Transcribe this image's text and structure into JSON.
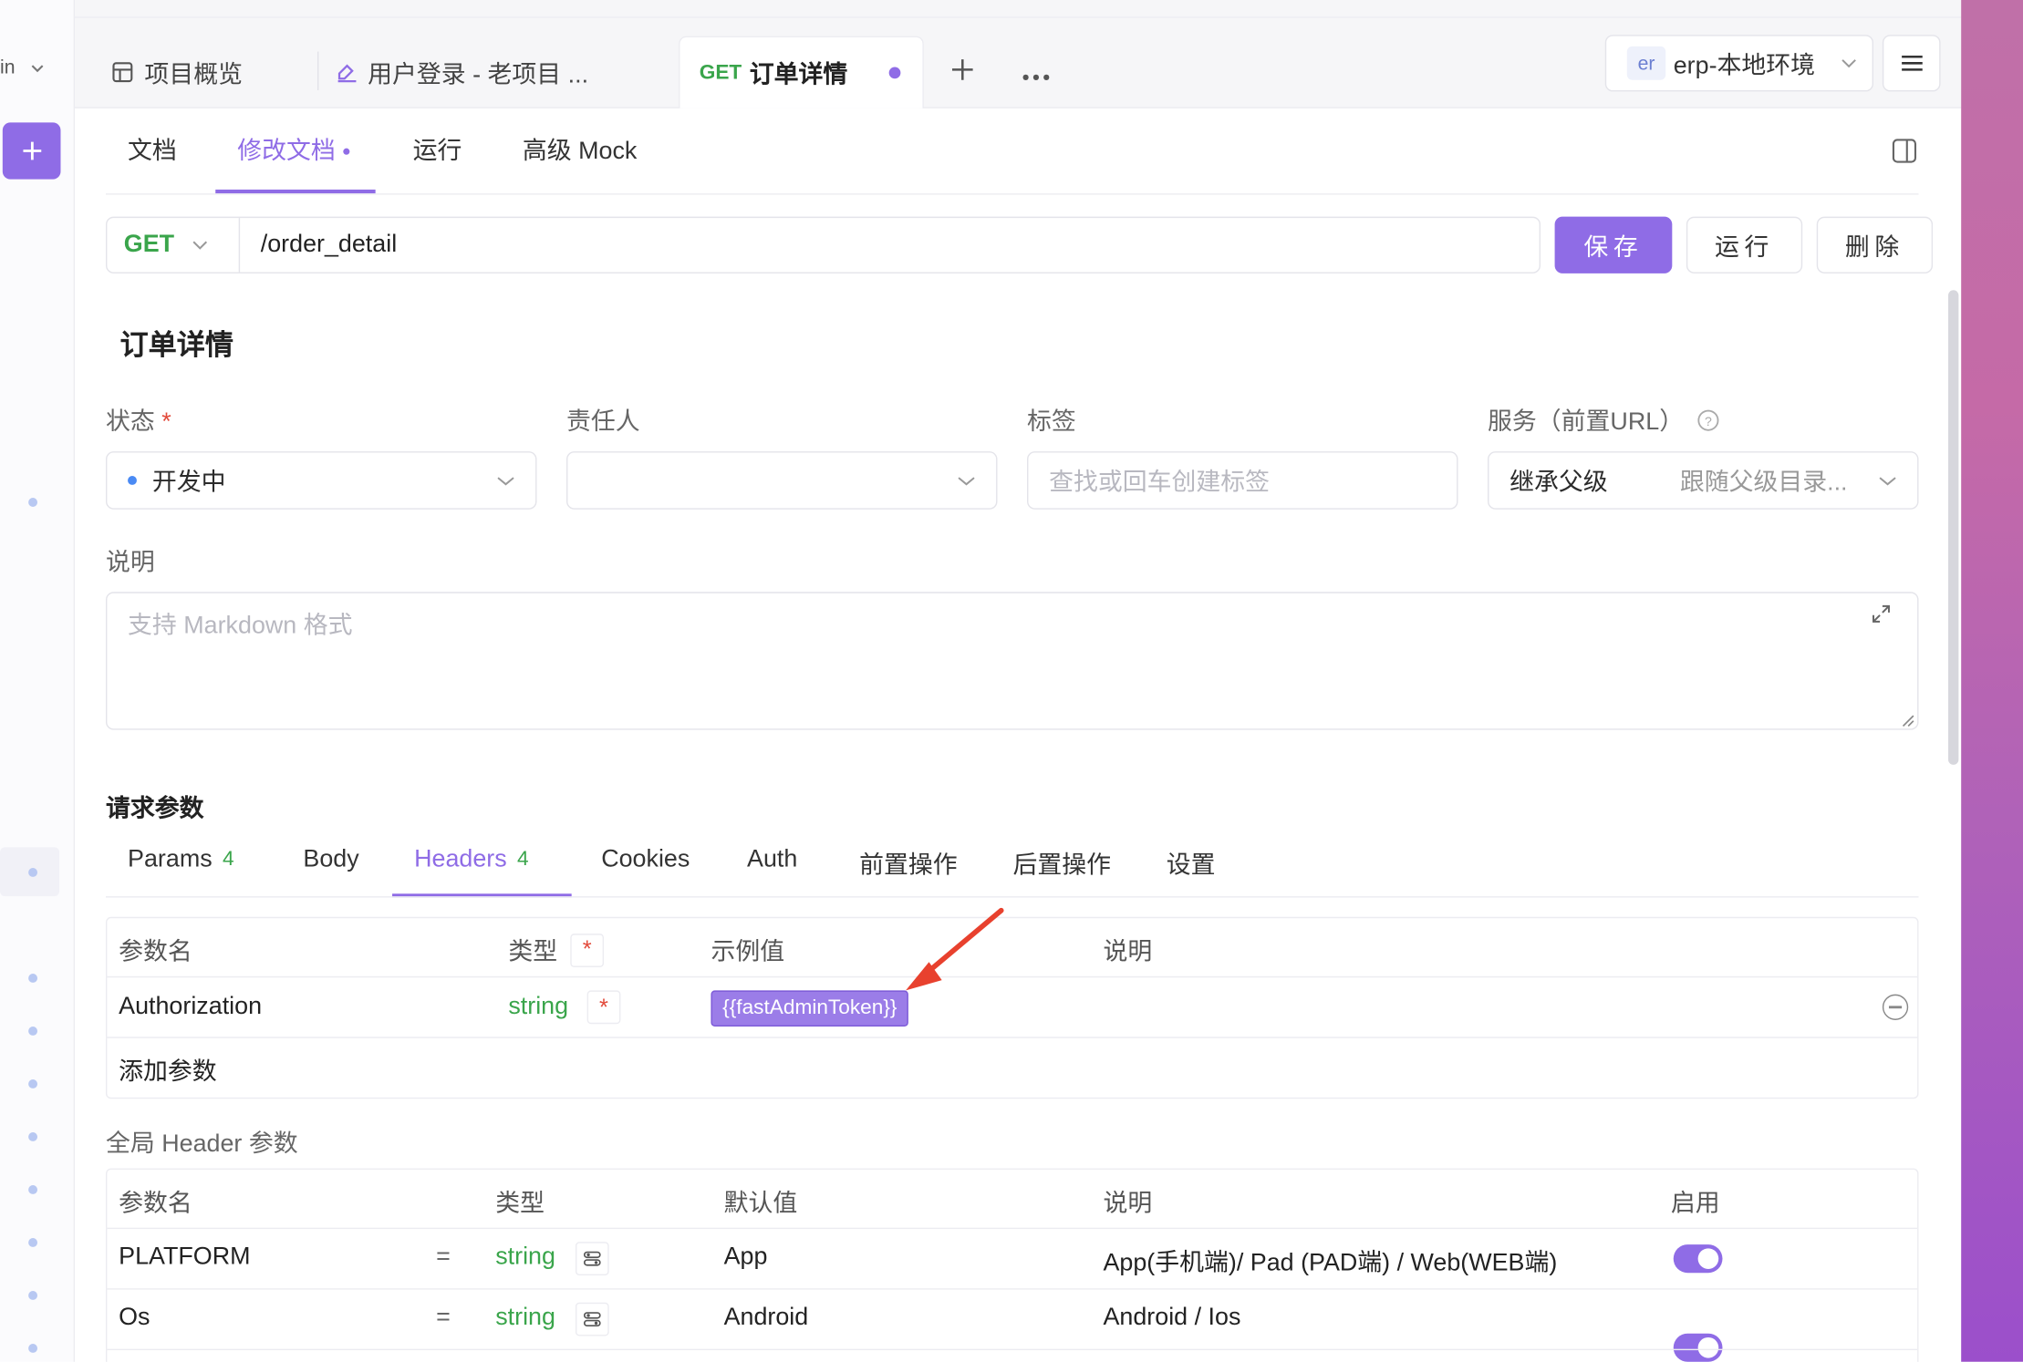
{
  "rail": {
    "top_label": "in",
    "add_icon": "plus-icon"
  },
  "tabs": [
    {
      "icon": "layout-icon",
      "label": "项目概览"
    },
    {
      "icon": "api-icon",
      "label": "用户登录 - 老项目 ..."
    },
    {
      "method": "GET",
      "label": "订单详情",
      "active": true
    }
  ],
  "tabbar": {
    "add_icon": "plus-icon",
    "more_icon": "more-icon"
  },
  "env": {
    "badge": "er",
    "name": "erp-本地环境"
  },
  "subtabs": {
    "doc": "文档",
    "edit": "修改文档",
    "run": "运行",
    "mock": "高级 Mock"
  },
  "request": {
    "method": "GET",
    "path": "/order_detail"
  },
  "actions": {
    "save": "保存",
    "run": "运行",
    "delete": "删除"
  },
  "api_title": "订单详情",
  "fields": {
    "status_label": "状态",
    "status_required": "*",
    "status_value": "开发中",
    "owner_label": "责任人",
    "tags_label": "标签",
    "tags_placeholder": "查找或回车创建标签",
    "service_label": "服务（前置URL）",
    "service_value": "继承父级",
    "service_hint": "跟随父级目录..."
  },
  "description": {
    "label": "说明",
    "placeholder": "支持 Markdown 格式"
  },
  "params_section": "请求参数",
  "param_tabs": {
    "params": "Params",
    "params_count": "4",
    "body": "Body",
    "headers": "Headers",
    "headers_count": "4",
    "cookies": "Cookies",
    "auth": "Auth",
    "pre": "前置操作",
    "post": "后置操作",
    "settings": "设置"
  },
  "headers_table": {
    "cols": {
      "name": "参数名",
      "type": "类型",
      "example": "示例值",
      "desc": "说明"
    },
    "type_required": "*",
    "rows": [
      {
        "name": "Authorization",
        "type": "string",
        "required": "*",
        "example": "{{fastAdminToken}}"
      }
    ],
    "add_placeholder": "添加参数"
  },
  "global_headers": {
    "label": "全局 Header 参数",
    "cols": {
      "name": "参数名",
      "type": "类型",
      "default": "默认值",
      "desc": "说明",
      "enabled": "启用"
    },
    "rows": [
      {
        "name": "PLATFORM",
        "eq": "=",
        "type": "string",
        "default": "App",
        "desc": "App(手机端)/ Pad (PAD端) / Web(WEB端)",
        "enabled": true
      },
      {
        "name": "Os",
        "eq": "=",
        "type": "string",
        "default": "Android",
        "desc": "Android / Ios",
        "enabled": true
      }
    ]
  },
  "colors": {
    "accent": "#8f6ce6",
    "green": "#3aa54b",
    "required": "#e24a3b",
    "arrow": "#e8412e"
  }
}
